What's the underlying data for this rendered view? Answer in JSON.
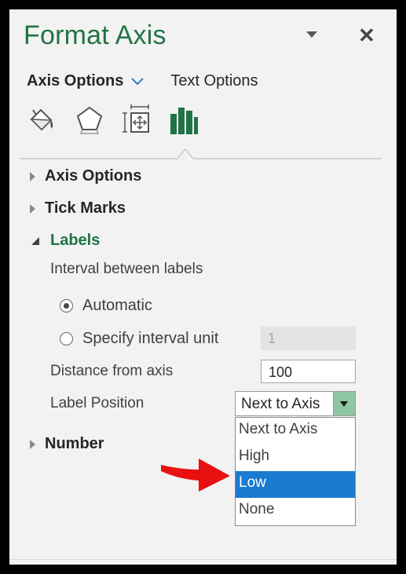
{
  "pane": {
    "title": "Format Axis",
    "close_glyph": "✕"
  },
  "tabs": {
    "active": "Axis Options",
    "other": "Text Options"
  },
  "icons": [
    "fill-line-icon",
    "effects-icon",
    "size-properties-icon",
    "axis-options-icon"
  ],
  "sections": {
    "axis_options": "Axis Options",
    "tick_marks": "Tick Marks",
    "labels": "Labels",
    "number": "Number"
  },
  "labels": {
    "interval_heading": "Interval between labels",
    "automatic": "Automatic",
    "specify": "Specify interval unit",
    "interval_value": "1",
    "distance_label": "Distance from axis",
    "distance_value": "100",
    "position_label": "Label Position",
    "position_value": "Next to Axis"
  },
  "dropdown": {
    "options": [
      "Next to Axis",
      "High",
      "Low",
      "None"
    ],
    "highlighted": "Low"
  },
  "colors": {
    "accent": "#217346",
    "highlight": "#1a7bd0",
    "annotation_arrow": "#e81010"
  }
}
